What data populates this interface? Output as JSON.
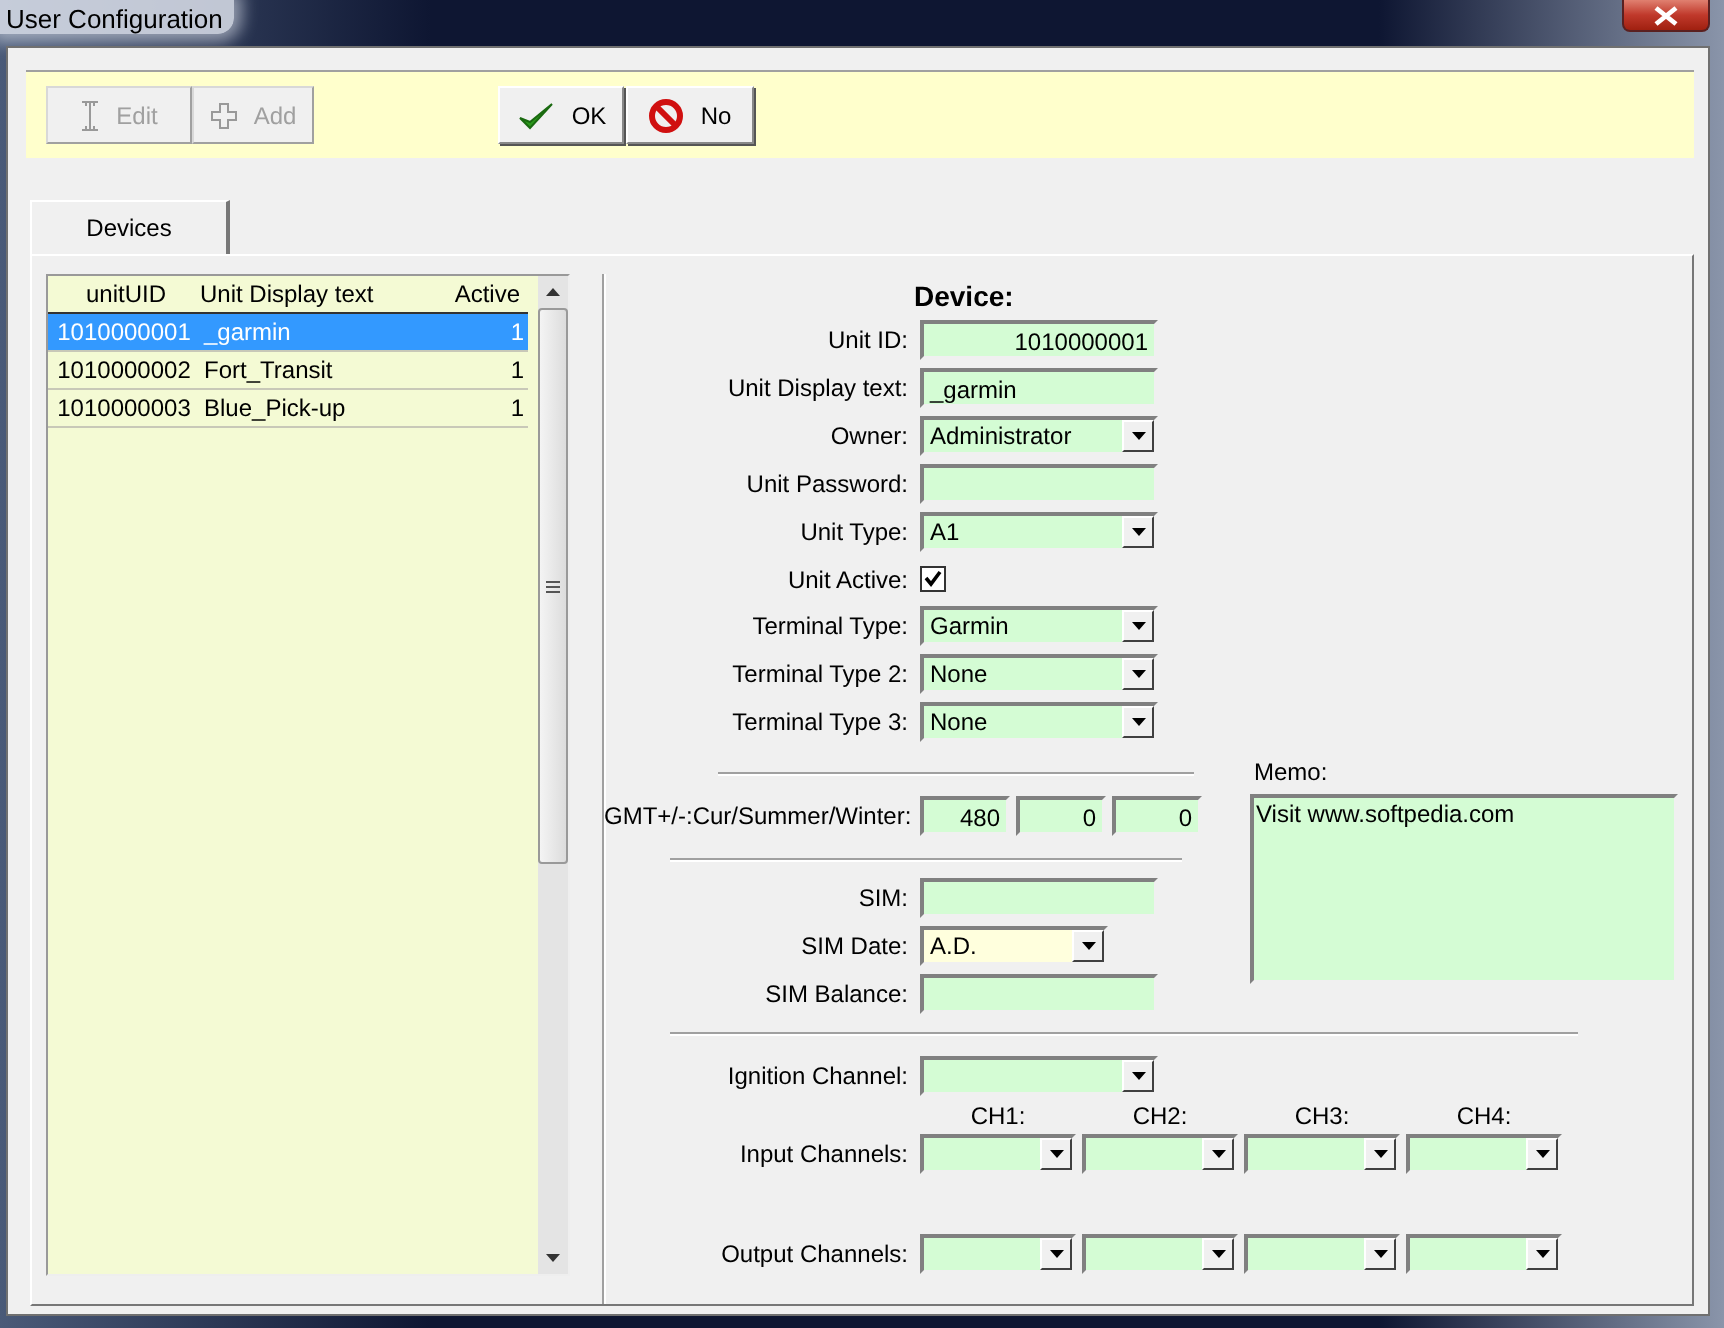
{
  "window": {
    "title": "User Configuration"
  },
  "toolbar": {
    "buttons": [
      {
        "label": "Edit",
        "kind": "edit",
        "disabled": true
      },
      {
        "label": "Add",
        "kind": "add",
        "disabled": true
      },
      {
        "label": "OK",
        "kind": "ok",
        "disabled": false
      },
      {
        "label": "No",
        "kind": "no",
        "disabled": false
      }
    ]
  },
  "tabs": [
    {
      "label": "Devices",
      "selected": true
    }
  ],
  "device_list": {
    "columns": [
      "unitUID",
      "Unit Display text",
      "Active"
    ],
    "rows": [
      {
        "cells": [
          "1010000001",
          "_garmin",
          "1"
        ],
        "selected": true
      },
      {
        "cells": [
          "1010000002",
          "Fort_Transit",
          "1"
        ],
        "selected": false
      },
      {
        "cells": [
          "1010000003",
          "Blue_Pick-up",
          "1"
        ],
        "selected": false
      }
    ]
  },
  "form": {
    "heading": "Device:",
    "fields": [
      {
        "label": "Unit ID:",
        "kind": "number",
        "value": "1010000001"
      },
      {
        "label": "Unit Display text:",
        "kind": "text",
        "value": "_garmin"
      },
      {
        "label": "Owner:",
        "kind": "select",
        "value": "Administrator"
      },
      {
        "label": "Unit Password:",
        "kind": "text"
      },
      {
        "label": "Unit Type:",
        "kind": "select",
        "value": "A1"
      },
      {
        "label": "Unit Active:",
        "kind": "checkbox",
        "checked": true
      },
      {
        "label": "Terminal Type:",
        "kind": "select",
        "value": "Garmin"
      },
      {
        "label": "Terminal Type 2:",
        "kind": "select",
        "value": "None"
      },
      {
        "label": "Terminal Type 3:",
        "kind": "select",
        "value": "None"
      }
    ],
    "timezone": {
      "label": "GMT+/-:Cur/Summer/Winter:",
      "values": [
        "480",
        "0",
        "0"
      ]
    },
    "sim_fields": [
      {
        "label": "SIM:",
        "kind": "text"
      },
      {
        "label": "SIM Date:",
        "kind": "date-select",
        "value": "A.D."
      },
      {
        "label": "SIM Balance:",
        "kind": "text"
      }
    ],
    "memo": {
      "label": "Memo:",
      "value": "Visit www.softpedia.com"
    },
    "ignition": {
      "label": "Ignition Channel:"
    },
    "channel_headers": [
      "CH1:",
      "CH2:",
      "CH3:",
      "CH4:"
    ],
    "input_channels": {
      "label": "Input Channels:"
    },
    "output_channels": {
      "label": "Output Channels:"
    }
  }
}
